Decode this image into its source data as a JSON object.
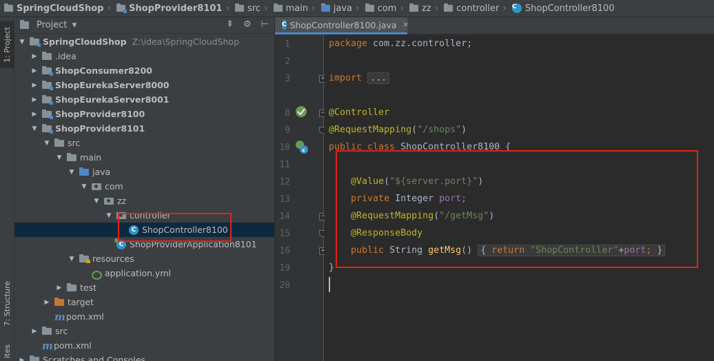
{
  "breadcrumbs": [
    {
      "label": "SpringCloudShop",
      "bold": true,
      "icon": "folder-icon"
    },
    {
      "label": "ShopProvider8101",
      "bold": true,
      "icon": "module-icon"
    },
    {
      "label": "src",
      "bold": false,
      "icon": "folder-icon"
    },
    {
      "label": "main",
      "bold": false,
      "icon": "folder-icon"
    },
    {
      "label": "java",
      "bold": false,
      "icon": "folder-icon"
    },
    {
      "label": "com",
      "bold": false,
      "icon": "folder-icon"
    },
    {
      "label": "zz",
      "bold": false,
      "icon": "folder-icon"
    },
    {
      "label": "controller",
      "bold": false,
      "icon": "folder-icon"
    },
    {
      "label": "ShopController8100",
      "bold": false,
      "icon": "class-icon"
    }
  ],
  "side_stripe": {
    "project_tab": "1: Project",
    "structure_tab": "7: Structure",
    "favorites_tab": "ites"
  },
  "project_panel": {
    "title": "Project",
    "tree": [
      {
        "label": "SpringCloudShop",
        "path": "Z:\\idea\\SpringCloudShop",
        "bold": true,
        "arrow": "down",
        "icon": "folder-mod",
        "level": 0
      },
      {
        "label": ".idea",
        "bold": false,
        "arrow": "right",
        "icon": "folder",
        "level": 1
      },
      {
        "label": "ShopConsumer8200",
        "bold": true,
        "arrow": "right",
        "icon": "folder-mod",
        "level": 1
      },
      {
        "label": "ShopEurekaServer8000",
        "bold": true,
        "arrow": "right",
        "icon": "folder-mod",
        "level": 1
      },
      {
        "label": "ShopEurekaServer8001",
        "bold": true,
        "arrow": "right",
        "icon": "folder-mod",
        "level": 1
      },
      {
        "label": "ShopProvider8100",
        "bold": true,
        "arrow": "right",
        "icon": "folder-mod",
        "level": 1
      },
      {
        "label": "ShopProvider8101",
        "bold": true,
        "arrow": "down",
        "icon": "folder-mod",
        "level": 1
      },
      {
        "label": "src",
        "bold": false,
        "arrow": "down",
        "icon": "folder",
        "level": 2
      },
      {
        "label": "main",
        "bold": false,
        "arrow": "down",
        "icon": "folder",
        "level": 3
      },
      {
        "label": "java",
        "bold": false,
        "arrow": "down",
        "icon": "folder-blue",
        "level": 4
      },
      {
        "label": "com",
        "bold": false,
        "arrow": "down",
        "icon": "package",
        "level": 5
      },
      {
        "label": "zz",
        "bold": false,
        "arrow": "down",
        "icon": "package",
        "level": 6
      },
      {
        "label": "controller",
        "bold": false,
        "arrow": "down",
        "icon": "package",
        "level": 7
      },
      {
        "label": "ShopController8100",
        "bold": false,
        "arrow": "",
        "icon": "class",
        "level": 8,
        "selected": true
      },
      {
        "label": "ShopProviderApplication8101",
        "bold": false,
        "arrow": "",
        "icon": "class-spring",
        "level": 7
      },
      {
        "label": "resources",
        "bold": false,
        "arrow": "down",
        "icon": "folder-res",
        "level": 4
      },
      {
        "label": "application.yml",
        "bold": false,
        "arrow": "",
        "icon": "yml",
        "level": 5
      },
      {
        "label": "test",
        "bold": false,
        "arrow": "right",
        "icon": "folder",
        "level": 3
      },
      {
        "label": "target",
        "bold": false,
        "arrow": "right",
        "icon": "folder-orange",
        "level": 2
      },
      {
        "label": "pom.xml",
        "bold": false,
        "arrow": "",
        "icon": "maven",
        "level": 2
      },
      {
        "label": "src",
        "bold": false,
        "arrow": "right",
        "icon": "folder",
        "level": 1
      },
      {
        "label": "pom.xml",
        "bold": false,
        "arrow": "",
        "icon": "maven",
        "level": 1
      },
      {
        "label": "Scratches and Consoles",
        "bold": false,
        "arrow": "right",
        "icon": "scratch",
        "level": 0
      }
    ]
  },
  "editor": {
    "tab_label": "ShopController8100.java",
    "line_numbers": [
      "1",
      "2",
      "3",
      "8",
      "9",
      "10",
      "11",
      "12",
      "13",
      "14",
      "15",
      "16",
      "19",
      "20"
    ],
    "code": {
      "l1_kw": "package",
      "l1_rest": " com.zz.controller;",
      "l3_kw": "import",
      "l3_fold": "...",
      "l8_ann": "@Controller",
      "l9_ann": "@RequestMapping",
      "l9_open": "(",
      "l9_str": "\"/shops\"",
      "l9_close": ")",
      "l10_kw": "public class",
      "l10_rest": " ShopController8100 {",
      "l12_ann": "@Value",
      "l12_open": "(",
      "l12_str": "\"${server.port}\"",
      "l12_close": ")",
      "l13_kw": "private",
      "l13_type": " Integer ",
      "l13_field": "port",
      "l13_semi": ";",
      "l14_ann": "@RequestMapping",
      "l14_open": "(",
      "l14_str": "\"/getMsg\"",
      "l14_close": ")",
      "l15_ann": "@ResponseBody",
      "l16_kw": "public",
      "l16_type": " String ",
      "l16_method": "getMsg",
      "l16_parens": "() ",
      "l16_fold_open": "{ ",
      "l16_return": "return ",
      "l16_str": "\"ShopController\"",
      "l16_plus": "+",
      "l16_field": "port",
      "l16_semi": "; ",
      "l16_fold_close": "}",
      "l19_brace": "}"
    }
  },
  "colors": {
    "keyword": "#cc7832",
    "annotation": "#bbb529",
    "string": "#6a8759",
    "field": "#9876aa",
    "method": "#ffc66d",
    "highlight_box": "#e0231b"
  }
}
